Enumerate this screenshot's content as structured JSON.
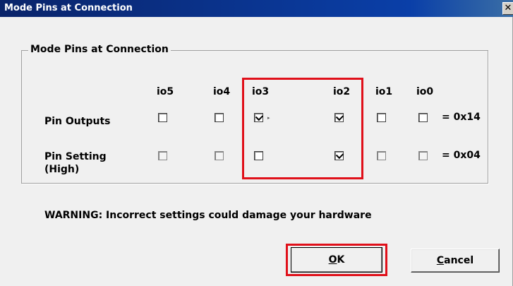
{
  "window": {
    "title": "Mode Pins at Connection",
    "close_glyph": "✕"
  },
  "group": {
    "legend": "Mode Pins at Connection"
  },
  "columns": [
    "io5",
    "io4",
    "io3",
    "io2",
    "io1",
    "io0"
  ],
  "rows": [
    {
      "label": "Pin Outputs",
      "checked": [
        false,
        false,
        true,
        true,
        false,
        false
      ],
      "enabled": [
        true,
        true,
        true,
        true,
        true,
        true
      ],
      "value": "= 0x14"
    },
    {
      "label": "Pin Setting (High)",
      "checked": [
        false,
        false,
        false,
        true,
        false,
        false
      ],
      "enabled": [
        false,
        false,
        true,
        true,
        false,
        false
      ],
      "value": "= 0x04"
    }
  ],
  "warning": "WARNING: Incorrect settings could damage your hardware",
  "buttons": {
    "ok": "OK",
    "cancel": "Cancel"
  },
  "colors": {
    "title_bar": "#0a246a",
    "highlight": "#e0101a",
    "dialog_bg": "#f0f0f0"
  }
}
